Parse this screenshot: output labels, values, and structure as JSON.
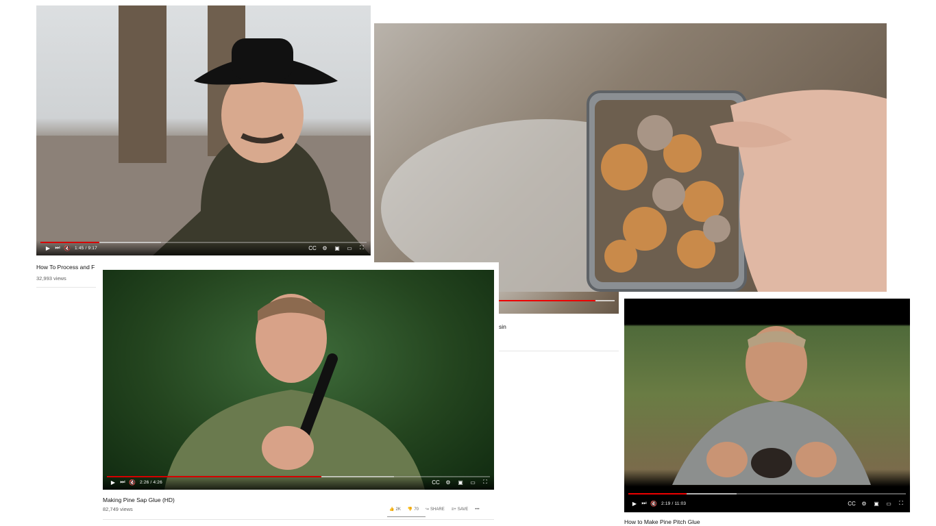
{
  "videos": [
    {
      "title": "How To Process and F",
      "views": "32,993 views",
      "time": "1:45 / 9:17",
      "progress": 0.18,
      "buffered": 0.37
    },
    {
      "title_fragment": "sin",
      "progress": 0.92,
      "buffered": 1.0
    },
    {
      "title": "Making Pine Sap Glue (HD)",
      "views": "82,749 views",
      "time": "2:26 / 4:26",
      "progress": 0.56,
      "buffered": 0.75,
      "actions": {
        "like": "2K",
        "dislike": "70",
        "share": "SHARE",
        "save": "SAVE"
      }
    },
    {
      "title": "How to Make Pine Pitch Glue",
      "time": "2:19 / 11:03",
      "progress": 0.21,
      "buffered": 0.39
    }
  ],
  "icons": {
    "play": "play-icon",
    "next": "next-icon",
    "mute": "mute-icon",
    "cc": "cc-icon",
    "settings": "gear-icon",
    "miniplayer": "miniplayer-icon",
    "theater": "theater-icon",
    "fullscreen": "fullscreen-icon"
  },
  "colors": {
    "progress": "#e00000",
    "text": "#111111",
    "meta": "#606060"
  }
}
